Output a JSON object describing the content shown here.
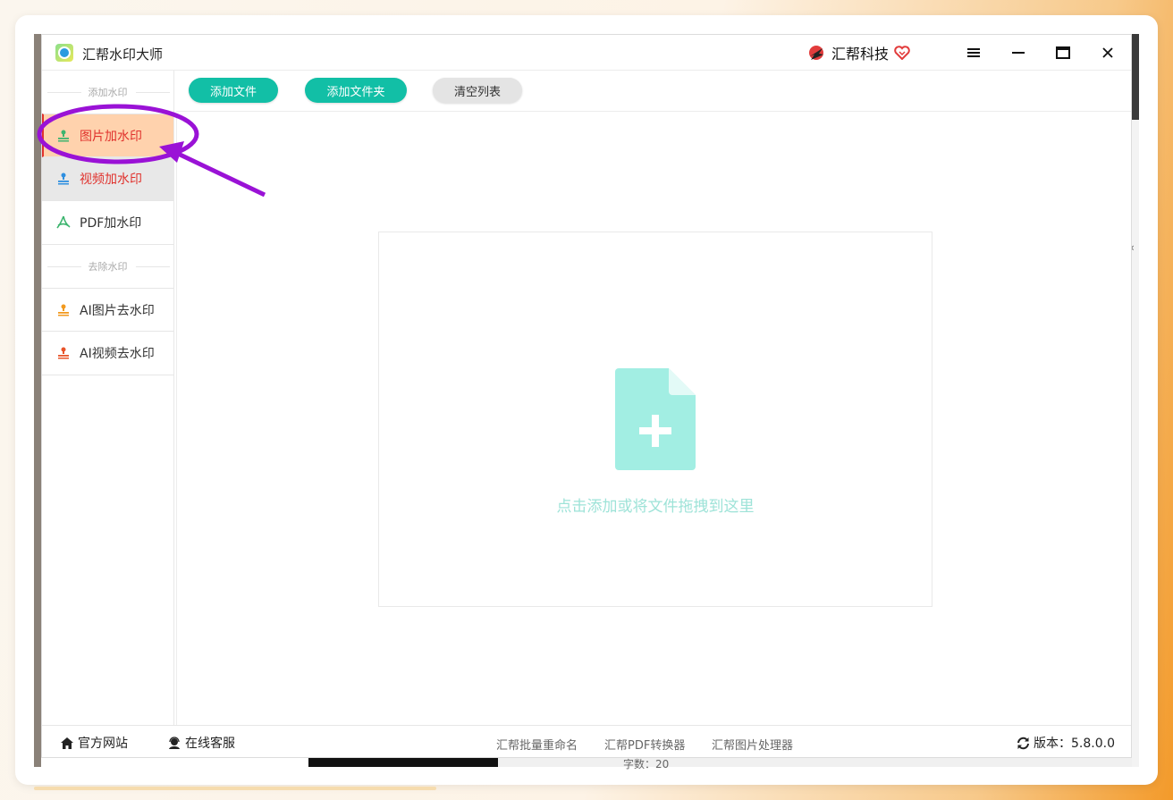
{
  "window": {
    "title": "汇帮水印大师",
    "brand": "汇帮科技"
  },
  "toolbar": {
    "add_file": "添加文件",
    "add_folder": "添加文件夹",
    "clear_list": "清空列表"
  },
  "sidebar": {
    "section_add": "添加水印",
    "section_remove": "去除水印",
    "items": [
      {
        "label": "图片加水印"
      },
      {
        "label": "视频加水印"
      },
      {
        "label": "PDF加水印"
      },
      {
        "label": "AI图片去水印"
      },
      {
        "label": "AI视频去水印"
      }
    ]
  },
  "dropzone": {
    "hint": "点击添加或将文件拖拽到这里"
  },
  "footer": {
    "website": "官方网站",
    "support": "在线客服",
    "tools": [
      "汇帮批量重命名",
      "汇帮PDF转换器",
      "汇帮图片处理器"
    ],
    "version": "版本：5.8.0.0"
  },
  "background": {
    "chars_text": "字数：20"
  },
  "colors": {
    "accent": "#12bfa6",
    "active_bg": "#ffd2ad",
    "active_text": "#e0322d",
    "annotation": "#9a12d6"
  }
}
